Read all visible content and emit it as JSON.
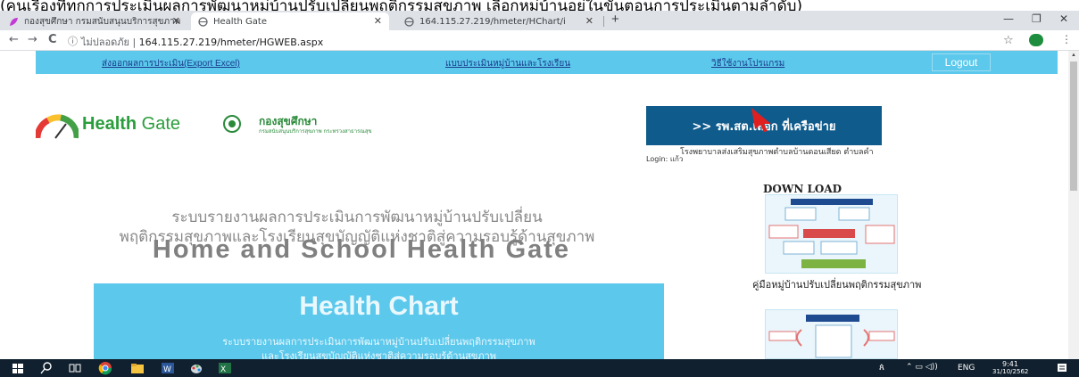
{
  "os_caption": "(คนเรื่องที่ทุกการประเมินผลการพัฒนาหมู่บ้านปรับเปลี่ยนพฤติกรรมสุขภาพ เลือกหมู่บ้านอยู่ในขั้นตอนการประเมินตามลำดับ)",
  "browser": {
    "tabs": [
      {
        "title": "กองสุขศึกษา กรมสนับสนุนบริการสุขภาพ"
      },
      {
        "title": "Health Gate"
      },
      {
        "title": "164.115.27.219/hmeter/HChart/i"
      }
    ],
    "new_tab": "+",
    "controls": {
      "minimize": "—",
      "maximize": "❐",
      "close": "✕"
    },
    "nav": {
      "back": "←",
      "forward": "→",
      "reload": "C"
    },
    "security_label": "ไม่ปลอดภัย",
    "url": "164.115.27.219/hmeter/HGWEB.aspx",
    "star": "☆",
    "menu": "⋮"
  },
  "topnav": {
    "export": "ส่งออกผลการประเมิน(Export Excel)",
    "assessment_form": "แบบประเมินหมู่บ้านและโรงเรียน",
    "howto": "วิธีใช้งานโปรแกรม",
    "logout": "Logout"
  },
  "brand": {
    "health": "Health",
    "gate": " Gate",
    "dept_name": "กองสุขศึกษา",
    "dept_sub": "กรมสนับสนุนบริการสุขภาพ กระทรวงสาธารณสุข"
  },
  "hospital": {
    "button": ">> รพ.สต.เลือก      ที่เครือข่าย",
    "name": "โรงพยาบาลส่งเสริมสุขภาพตำบลบ้านดอนเสียด ตำบลคำ",
    "login": "Login: แก้ว"
  },
  "system": {
    "line1": "ระบบรายงานผลการประเมินการพัฒนาหมู่บ้านปรับเปลี่ยน",
    "line2": "พฤติกรรมสุขภาพและโรงเรียนสุขบัญญัติแห่งชาติสู่ความรอบรู้ด้านสุขภาพ",
    "title": "Home and School Health Gate"
  },
  "chart_panel": {
    "title": "Health Chart",
    "sub1": "ระบบรายงานผลการประเมินการพัฒนาหมู่บ้านปรับเปลี่ยนพฤติกรรมสุขภาพ",
    "sub2": "และโรงเรียนสุขบัญญัติแห่งชาติสู่ความรอบรู้ด้านสุขภาพ"
  },
  "download": {
    "title": "DOWN LOAD",
    "manual1_caption": "คู่มือหมู่บ้านปรับเปลี่ยนพฤติกรรมสุขภาพ"
  },
  "taskbar": {
    "ime": "ENG",
    "time": "9:41",
    "date": "31/10/2562"
  },
  "colors": {
    "nav_bg": "#5bc8ec",
    "hospital_btn": "#0f5b8c",
    "brand_green": "#2a9d3c",
    "taskbar": "#10202e"
  }
}
